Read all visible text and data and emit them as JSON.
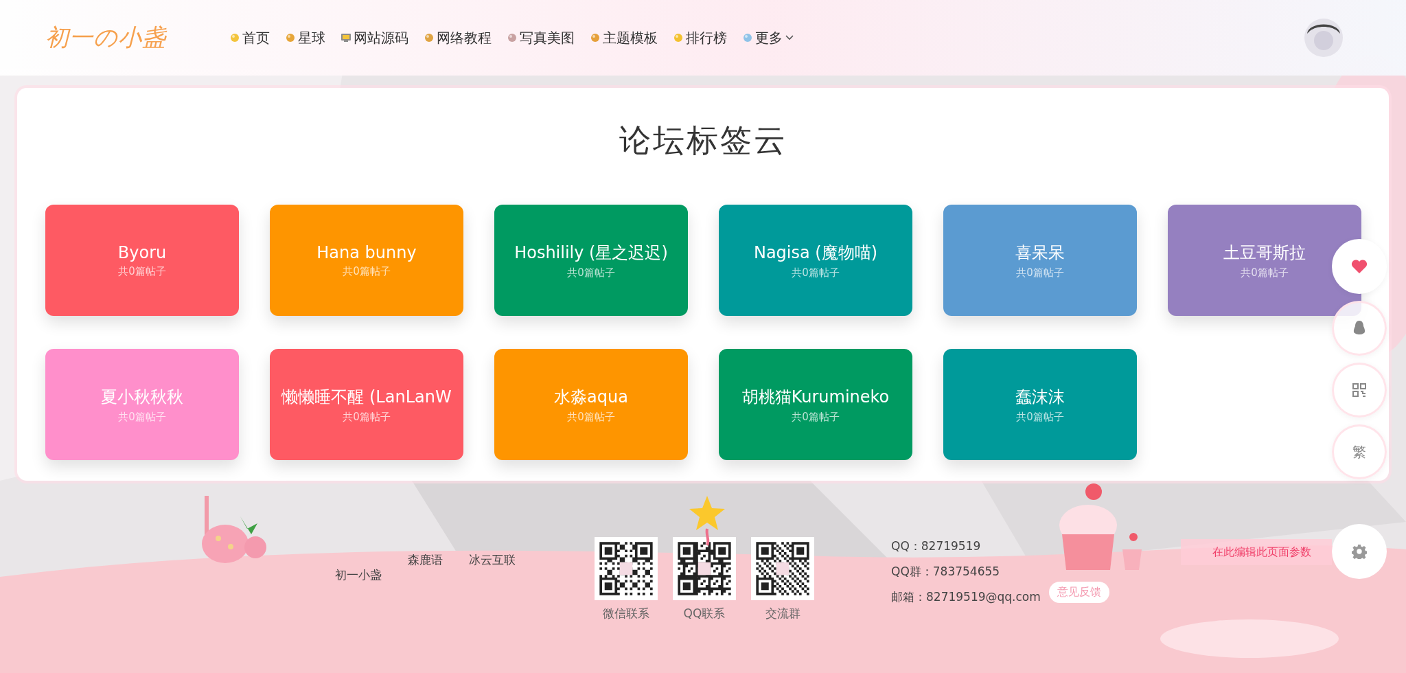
{
  "header": {
    "logo": "初一の小盏",
    "nav": [
      {
        "label": "首页",
        "has_menu": false
      },
      {
        "label": "星球",
        "has_menu": false
      },
      {
        "label": "网站源码",
        "has_menu": false
      },
      {
        "label": "网络教程",
        "has_menu": false
      },
      {
        "label": "写真美图",
        "has_menu": false
      },
      {
        "label": "主题模板",
        "has_menu": false
      },
      {
        "label": "排行榜",
        "has_menu": false
      },
      {
        "label": "更多",
        "has_menu": true
      }
    ]
  },
  "main": {
    "title": "论坛标签云",
    "tags": [
      {
        "name": "Byoru",
        "count": "共0篇帖子",
        "color": "#fe5a63"
      },
      {
        "name": "Hana bunny",
        "count": "共0篇帖子",
        "color": "#fe9500"
      },
      {
        "name": "Hoshilily (星之迟迟)",
        "count": "共0篇帖子",
        "color": "#009a61"
      },
      {
        "name": "Nagisa (魔物喵)",
        "count": "共0篇帖子",
        "color": "#009a9a"
      },
      {
        "name": "喜呆呆",
        "count": "共0篇帖子",
        "color": "#5b9bd1"
      },
      {
        "name": "土豆哥斯拉",
        "count": "共0篇帖子",
        "color": "#9580c0"
      },
      {
        "name": "夏小秋秋秋",
        "count": "共0篇帖子",
        "color": "#ff8fcb"
      },
      {
        "name": "懒懒睡不醒 (LanLanW",
        "count": "共0篇帖子",
        "color": "#fe5a63"
      },
      {
        "name": "水淼aqua",
        "count": "共0篇帖子",
        "color": "#fe9500"
      },
      {
        "name": "胡桃猫Kurumineko",
        "count": "共0篇帖子",
        "color": "#009a61"
      },
      {
        "name": "蠢沫沫",
        "count": "共0篇帖子",
        "color": "#009a9a"
      }
    ]
  },
  "side_buttons": [
    {
      "kind": "heart"
    },
    {
      "kind": "penguin"
    },
    {
      "kind": "qr"
    },
    {
      "kind": "text",
      "label": "繁"
    }
  ],
  "footer": {
    "links": [
      "初一小盏",
      "森鹿语",
      "冰云互联"
    ],
    "qr_codes": [
      {
        "caption": "微信联系"
      },
      {
        "caption": "QQ联系"
      },
      {
        "caption": "交流群"
      }
    ],
    "contacts": [
      "QQ：82719519",
      "QQ群：783754655",
      "邮箱：82719519@qq.com"
    ],
    "feedback": "意见反馈",
    "edit_params": "在此编辑此页面参数"
  }
}
